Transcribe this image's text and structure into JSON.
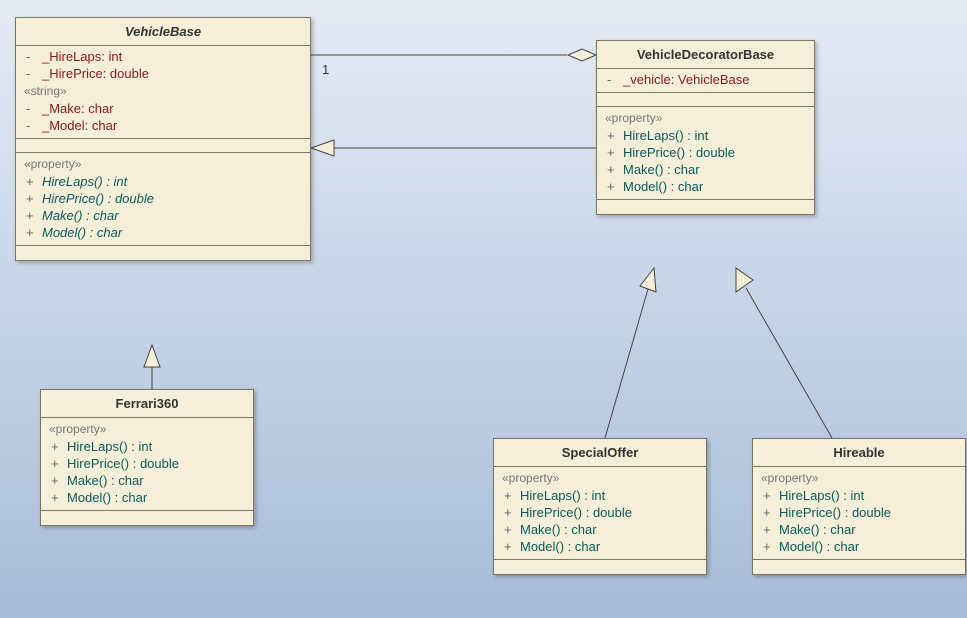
{
  "classes": {
    "vehiclebase": {
      "name": "VehicleBase",
      "abstract": true,
      "attrs1": [
        {
          "vis": "-",
          "text": "_HireLaps:  int"
        },
        {
          "vis": "-",
          "text": "_HirePrice:  double"
        }
      ],
      "stereo1": "«string»",
      "attrs2": [
        {
          "vis": "-",
          "text": "_Make:  char"
        },
        {
          "vis": "-",
          "text": "_Model:  char"
        }
      ],
      "stereo2": "«property»",
      "ops": [
        {
          "vis": "+",
          "text": "HireLaps() : int",
          "italic": true
        },
        {
          "vis": "+",
          "text": "HirePrice() : double",
          "italic": true
        },
        {
          "vis": "+",
          "text": "Make() : char",
          "italic": true
        },
        {
          "vis": "+",
          "text": "Model() : char",
          "italic": true
        }
      ]
    },
    "vehicledecoratorbase": {
      "name": "VehicleDecoratorBase",
      "attrs": [
        {
          "vis": "-",
          "text": "_vehicle:  VehicleBase"
        }
      ],
      "stereo": "«property»",
      "ops": [
        {
          "vis": "+",
          "text": "HireLaps() : int"
        },
        {
          "vis": "+",
          "text": "HirePrice() : double"
        },
        {
          "vis": "+",
          "text": "Make() : char"
        },
        {
          "vis": "+",
          "text": "Model() : char"
        }
      ]
    },
    "ferrari360": {
      "name": "Ferrari360",
      "stereo": "«property»",
      "ops": [
        {
          "vis": "+",
          "text": "HireLaps() : int"
        },
        {
          "vis": "+",
          "text": "HirePrice() : double"
        },
        {
          "vis": "+",
          "text": "Make() : char"
        },
        {
          "vis": "+",
          "text": "Model() : char"
        }
      ]
    },
    "specialoffer": {
      "name": "SpecialOffer",
      "stereo": "«property»",
      "ops": [
        {
          "vis": "+",
          "text": "HireLaps() : int"
        },
        {
          "vis": "+",
          "text": "HirePrice() : double"
        },
        {
          "vis": "+",
          "text": "Make() : char"
        },
        {
          "vis": "+",
          "text": "Model() : char"
        }
      ]
    },
    "hireable": {
      "name": "Hireable",
      "stereo": "«property»",
      "ops": [
        {
          "vis": "+",
          "text": "HireLaps() : int"
        },
        {
          "vis": "+",
          "text": "HirePrice() : double"
        },
        {
          "vis": "+",
          "text": "Make() : char"
        },
        {
          "vis": "+",
          "text": "Model() : char"
        }
      ]
    }
  },
  "multiplicity": "1"
}
